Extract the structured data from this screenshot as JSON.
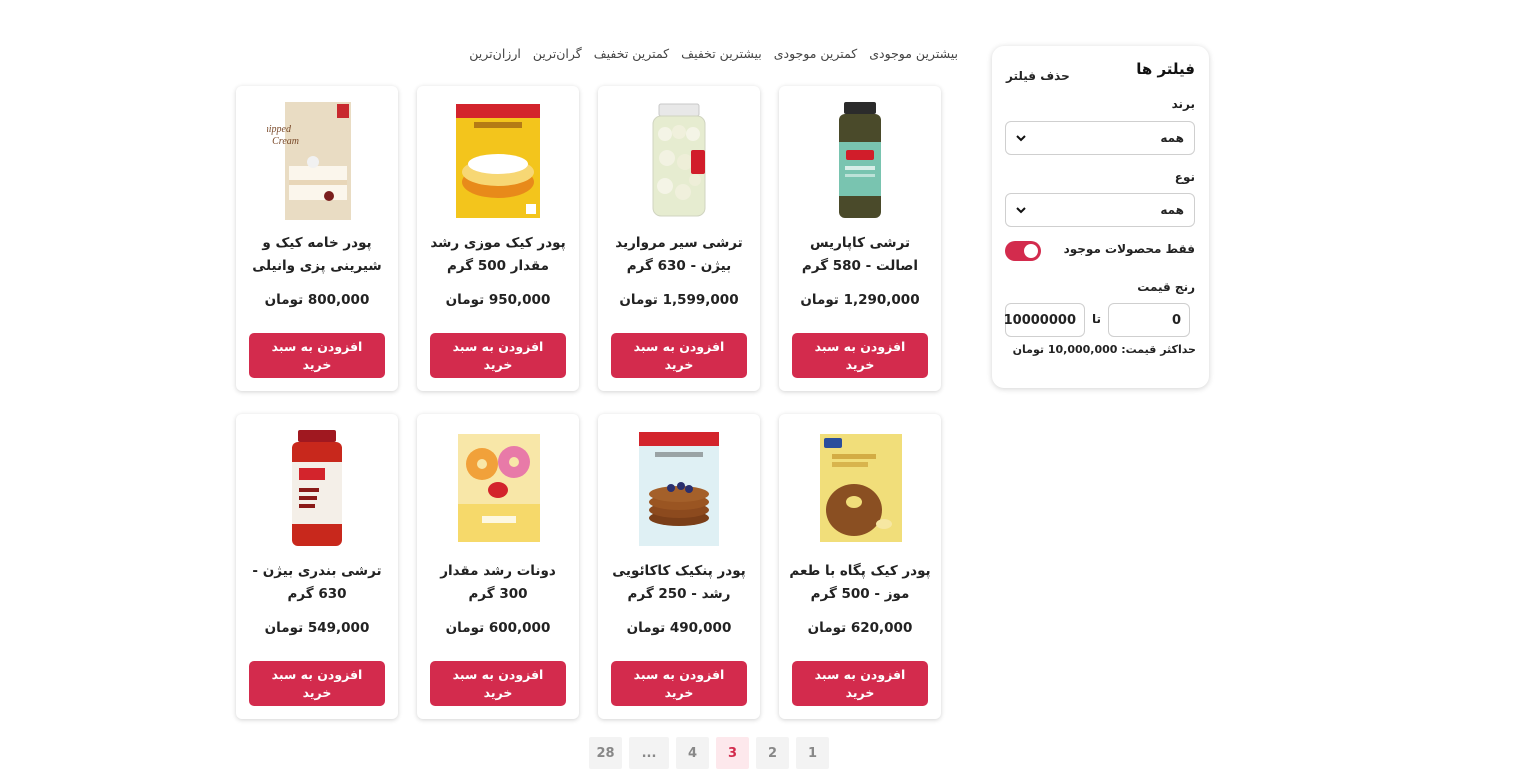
{
  "sort_options": [
    "بیشترین موجودی",
    "کمترین موجودی",
    "بیشترین تخفیف",
    "کمترین تخفیف",
    "گران‌ترین",
    "ارزان‌ترین"
  ],
  "filters": {
    "title": "فیلتر ها",
    "clear_label": "حذف فیلتر",
    "brand_label": "برند",
    "brand_value": "همه",
    "type_label": "نوع",
    "type_value": "همه",
    "in_stock_label": "فقط محصولات موجود",
    "in_stock_enabled": true,
    "price_range_label": "رنج قیمت",
    "min_price": "0",
    "to_label": "تا",
    "max_price": "10000000",
    "max_price_note": "حداکثر قیمت: 10,000,000 تومان"
  },
  "products": [
    {
      "name": "ترشی کاپاریس اصالت - 580 گرم",
      "price": "1,290,000 تومان",
      "button": "افزودن به سبد خرید"
    },
    {
      "name": "ترشی سیر مروارید بیژن - 630 گرم",
      "price": "1,599,000 تومان",
      "button": "افزودن به سبد خرید"
    },
    {
      "name": "پودر کیک موزی رشد مقدار 500 گرم",
      "price": "950,000 تومان",
      "button": "افزودن به سبد خرید"
    },
    {
      "name": "پودر خامه کیک و شیرینی پزی وانیلی ر...",
      "price": "800,000 تومان",
      "button": "افزودن به سبد خرید"
    },
    {
      "name": "پودر کیک پگاه با طعم موز - 500 گرم",
      "price": "620,000 تومان",
      "button": "افزودن به سبد خرید"
    },
    {
      "name": "پودر پنکیک کاکائویی رشد - 250 گرم",
      "price": "490,000 تومان",
      "button": "افزودن به سبد خرید"
    },
    {
      "name": "دونات رشد مقدار 300 گرم",
      "price": "600,000 تومان",
      "button": "افزودن به سبد خرید"
    },
    {
      "name": "ترشی بندری بیژن - 630 گرم",
      "price": "549,000 تومان",
      "button": "افزودن به سبد خرید"
    }
  ],
  "pagination": {
    "pages": [
      "28",
      "...",
      "4",
      "3",
      "2",
      "1"
    ],
    "current": "3"
  },
  "colors": {
    "accent": "#d32b4d"
  }
}
